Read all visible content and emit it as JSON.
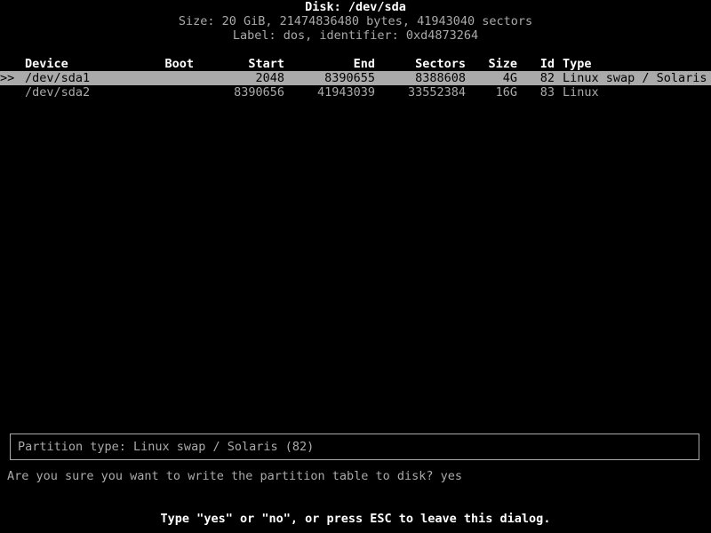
{
  "disk": {
    "title": "Disk: /dev/sda",
    "size_line": "Size: 20 GiB, 21474836480 bytes, 41943040 sectors",
    "label_line": "Label: dos, identifier: 0xd4873264"
  },
  "table": {
    "headers": {
      "marker": "",
      "device": "Device",
      "boot": "Boot",
      "start": "Start",
      "end": "End",
      "sectors": "Sectors",
      "size": "Size",
      "id": "Id",
      "type": "Type"
    },
    "rows": [
      {
        "marker": ">>",
        "device": "/dev/sda1",
        "boot": "",
        "start": "2048",
        "end": "8390655",
        "sectors": "8388608",
        "size": "4G",
        "id": "82",
        "type": "Linux swap / Solaris",
        "selected": true
      },
      {
        "marker": "",
        "device": "/dev/sda2",
        "boot": "",
        "start": "8390656",
        "end": "41943039",
        "sectors": "33552384",
        "size": "16G",
        "id": "83",
        "type": "Linux",
        "selected": false
      }
    ]
  },
  "info_box": {
    "text": "Partition type: Linux swap / Solaris (82)"
  },
  "prompt": {
    "question": "Are you sure you want to write the partition table to disk? yes",
    "hint": "Type \"yes\" or \"no\", or press ESC to leave this dialog."
  },
  "colors": {
    "background": "#000000",
    "text": "#aaaaaa",
    "bright_text": "#ffffff",
    "selection_background": "#aaaaaa",
    "selection_text": "#000000",
    "border": "#aaaaaa"
  }
}
